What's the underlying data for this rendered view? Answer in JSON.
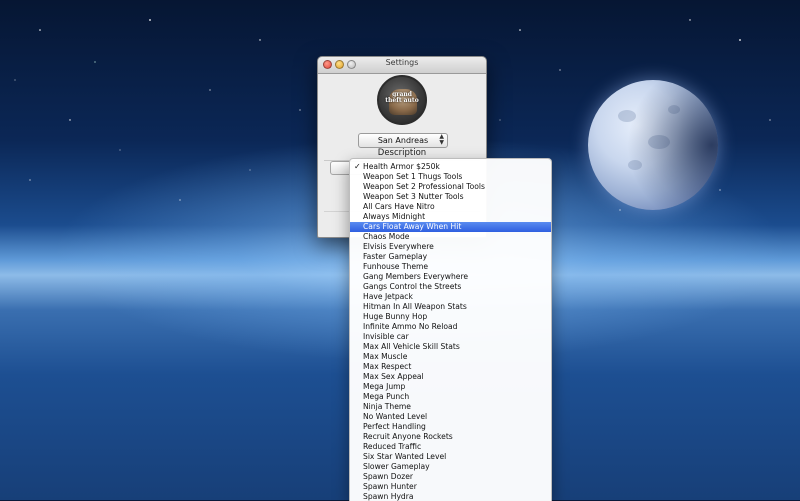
{
  "window": {
    "title": "Settings",
    "game_select_value": "San Andreas",
    "description_label": "Description",
    "logo_text": "grand theft auto"
  },
  "menu": {
    "checked_item": "Health Armor $250k",
    "highlighted_item": "Cars Float Away When Hit",
    "items": [
      "Health Armor $250k",
      "Weapon Set 1 Thugs Tools",
      "Weapon Set 2 Professional Tools",
      "Weapon Set 3 Nutter Tools",
      "All Cars Have Nitro",
      "Always Midnight",
      "Cars Float Away When Hit",
      "Chaos Mode",
      "Elvisis Everywhere",
      "Faster Gameplay",
      "Funhouse Theme",
      "Gang Members Everywhere",
      "Gangs Control the Streets",
      "Have Jetpack",
      "Hitman In All Weapon Stats",
      "Huge Bunny Hop",
      "Infinite Ammo No Reload",
      "Invisible car",
      "Max All Vehicle Skill Stats",
      "Max Muscle",
      "Max Respect",
      "Max Sex Appeal",
      "Mega Jump",
      "Mega Punch",
      "Ninja Theme",
      "No Wanted Level",
      "Perfect Handling",
      "Recruit Anyone Rockets",
      "Reduced Traffic",
      "Six Star Wanted Level",
      "Slower Gameplay",
      "Spawn Dozer",
      "Spawn Hunter",
      "Spawn Hydra"
    ]
  },
  "colors": {
    "highlight": "#2f5fe0",
    "close_button": "#e0463a",
    "minimize_button": "#e0a12a"
  }
}
